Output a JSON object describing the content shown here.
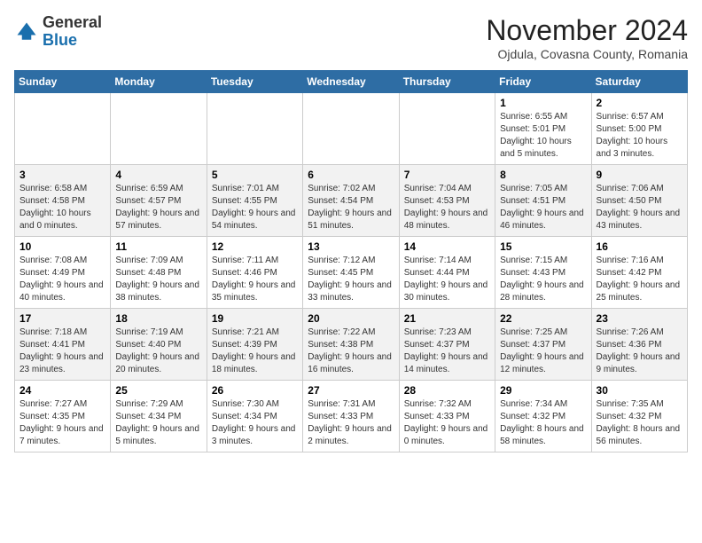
{
  "header": {
    "logo_line1": "General",
    "logo_line2": "Blue",
    "month_title": "November 2024",
    "subtitle": "Ojdula, Covasna County, Romania"
  },
  "weekdays": [
    "Sunday",
    "Monday",
    "Tuesday",
    "Wednesday",
    "Thursday",
    "Friday",
    "Saturday"
  ],
  "weeks": [
    [
      {
        "day": "",
        "info": ""
      },
      {
        "day": "",
        "info": ""
      },
      {
        "day": "",
        "info": ""
      },
      {
        "day": "",
        "info": ""
      },
      {
        "day": "",
        "info": ""
      },
      {
        "day": "1",
        "info": "Sunrise: 6:55 AM\nSunset: 5:01 PM\nDaylight: 10 hours and 5 minutes."
      },
      {
        "day": "2",
        "info": "Sunrise: 6:57 AM\nSunset: 5:00 PM\nDaylight: 10 hours and 3 minutes."
      }
    ],
    [
      {
        "day": "3",
        "info": "Sunrise: 6:58 AM\nSunset: 4:58 PM\nDaylight: 10 hours and 0 minutes."
      },
      {
        "day": "4",
        "info": "Sunrise: 6:59 AM\nSunset: 4:57 PM\nDaylight: 9 hours and 57 minutes."
      },
      {
        "day": "5",
        "info": "Sunrise: 7:01 AM\nSunset: 4:55 PM\nDaylight: 9 hours and 54 minutes."
      },
      {
        "day": "6",
        "info": "Sunrise: 7:02 AM\nSunset: 4:54 PM\nDaylight: 9 hours and 51 minutes."
      },
      {
        "day": "7",
        "info": "Sunrise: 7:04 AM\nSunset: 4:53 PM\nDaylight: 9 hours and 48 minutes."
      },
      {
        "day": "8",
        "info": "Sunrise: 7:05 AM\nSunset: 4:51 PM\nDaylight: 9 hours and 46 minutes."
      },
      {
        "day": "9",
        "info": "Sunrise: 7:06 AM\nSunset: 4:50 PM\nDaylight: 9 hours and 43 minutes."
      }
    ],
    [
      {
        "day": "10",
        "info": "Sunrise: 7:08 AM\nSunset: 4:49 PM\nDaylight: 9 hours and 40 minutes."
      },
      {
        "day": "11",
        "info": "Sunrise: 7:09 AM\nSunset: 4:48 PM\nDaylight: 9 hours and 38 minutes."
      },
      {
        "day": "12",
        "info": "Sunrise: 7:11 AM\nSunset: 4:46 PM\nDaylight: 9 hours and 35 minutes."
      },
      {
        "day": "13",
        "info": "Sunrise: 7:12 AM\nSunset: 4:45 PM\nDaylight: 9 hours and 33 minutes."
      },
      {
        "day": "14",
        "info": "Sunrise: 7:14 AM\nSunset: 4:44 PM\nDaylight: 9 hours and 30 minutes."
      },
      {
        "day": "15",
        "info": "Sunrise: 7:15 AM\nSunset: 4:43 PM\nDaylight: 9 hours and 28 minutes."
      },
      {
        "day": "16",
        "info": "Sunrise: 7:16 AM\nSunset: 4:42 PM\nDaylight: 9 hours and 25 minutes."
      }
    ],
    [
      {
        "day": "17",
        "info": "Sunrise: 7:18 AM\nSunset: 4:41 PM\nDaylight: 9 hours and 23 minutes."
      },
      {
        "day": "18",
        "info": "Sunrise: 7:19 AM\nSunset: 4:40 PM\nDaylight: 9 hours and 20 minutes."
      },
      {
        "day": "19",
        "info": "Sunrise: 7:21 AM\nSunset: 4:39 PM\nDaylight: 9 hours and 18 minutes."
      },
      {
        "day": "20",
        "info": "Sunrise: 7:22 AM\nSunset: 4:38 PM\nDaylight: 9 hours and 16 minutes."
      },
      {
        "day": "21",
        "info": "Sunrise: 7:23 AM\nSunset: 4:37 PM\nDaylight: 9 hours and 14 minutes."
      },
      {
        "day": "22",
        "info": "Sunrise: 7:25 AM\nSunset: 4:37 PM\nDaylight: 9 hours and 12 minutes."
      },
      {
        "day": "23",
        "info": "Sunrise: 7:26 AM\nSunset: 4:36 PM\nDaylight: 9 hours and 9 minutes."
      }
    ],
    [
      {
        "day": "24",
        "info": "Sunrise: 7:27 AM\nSunset: 4:35 PM\nDaylight: 9 hours and 7 minutes."
      },
      {
        "day": "25",
        "info": "Sunrise: 7:29 AM\nSunset: 4:34 PM\nDaylight: 9 hours and 5 minutes."
      },
      {
        "day": "26",
        "info": "Sunrise: 7:30 AM\nSunset: 4:34 PM\nDaylight: 9 hours and 3 minutes."
      },
      {
        "day": "27",
        "info": "Sunrise: 7:31 AM\nSunset: 4:33 PM\nDaylight: 9 hours and 2 minutes."
      },
      {
        "day": "28",
        "info": "Sunrise: 7:32 AM\nSunset: 4:33 PM\nDaylight: 9 hours and 0 minutes."
      },
      {
        "day": "29",
        "info": "Sunrise: 7:34 AM\nSunset: 4:32 PM\nDaylight: 8 hours and 58 minutes."
      },
      {
        "day": "30",
        "info": "Sunrise: 7:35 AM\nSunset: 4:32 PM\nDaylight: 8 hours and 56 minutes."
      }
    ]
  ]
}
